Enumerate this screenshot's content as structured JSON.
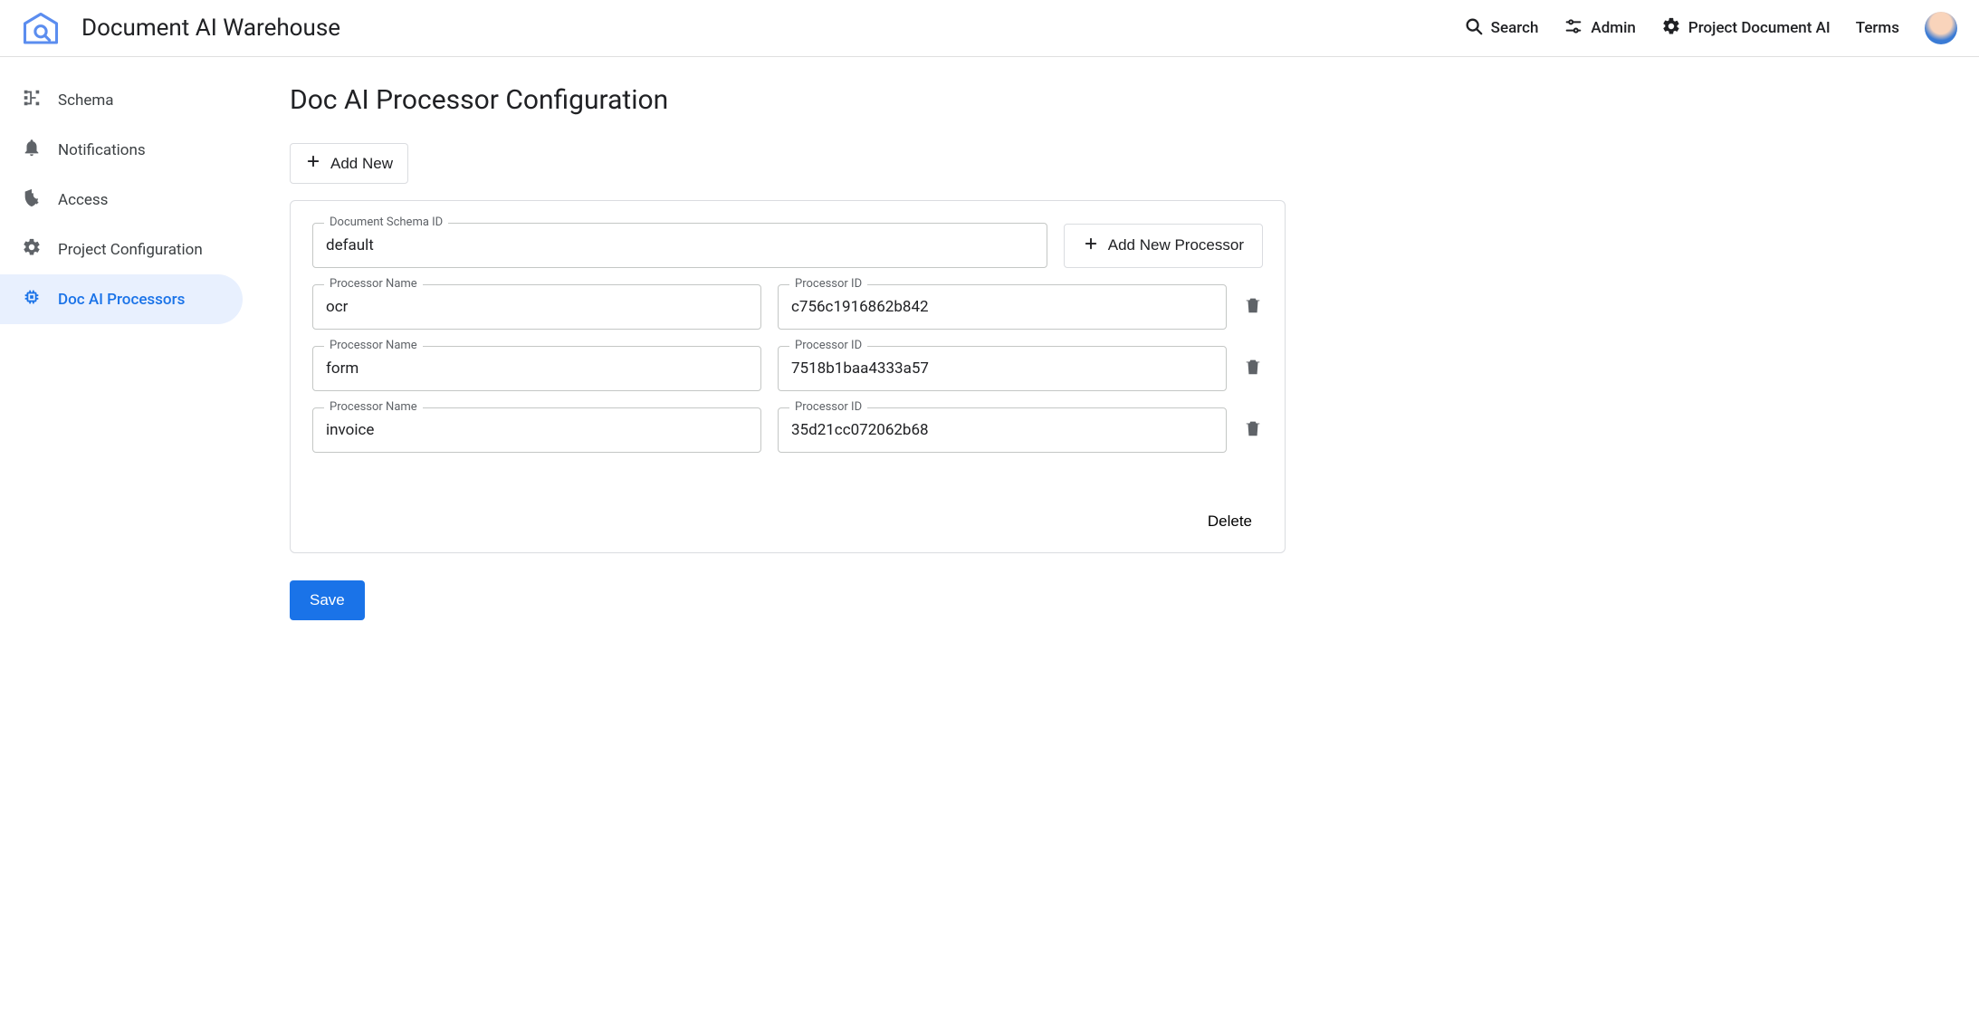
{
  "header": {
    "app_title": "Document AI Warehouse",
    "search": "Search",
    "admin": "Admin",
    "project": "Project Document AI",
    "terms": "Terms"
  },
  "sidebar": {
    "items": [
      {
        "label": "Schema"
      },
      {
        "label": "Notifications"
      },
      {
        "label": "Access"
      },
      {
        "label": "Project Configuration"
      },
      {
        "label": "Doc AI Processors"
      }
    ]
  },
  "page": {
    "title": "Doc AI Processor Configuration",
    "add_new": "Add New",
    "add_new_processor": "Add New Processor",
    "delete": "Delete",
    "save": "Save"
  },
  "labels": {
    "schema_id": "Document Schema ID",
    "processor_name": "Processor Name",
    "processor_id": "Processor ID"
  },
  "config": {
    "schema_id": "default",
    "processors": [
      {
        "name": "ocr",
        "id": "c756c1916862b842"
      },
      {
        "name": "form",
        "id": "7518b1baa4333a57"
      },
      {
        "name": "invoice",
        "id": "35d21cc072062b68"
      }
    ]
  }
}
